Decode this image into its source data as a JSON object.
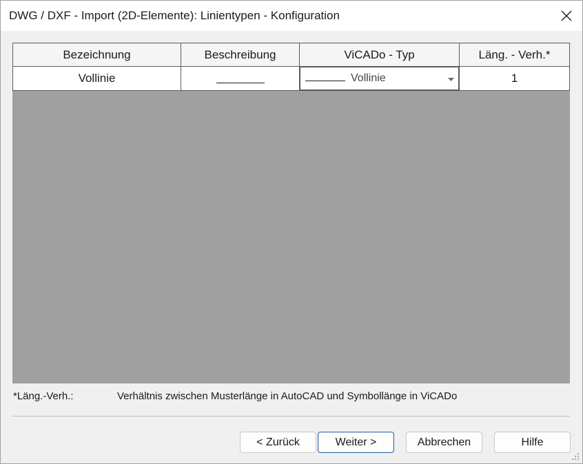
{
  "window": {
    "title": "DWG / DXF - Import (2D-Elemente): Linientypen - Konfiguration"
  },
  "table": {
    "columns": [
      "Bezeichnung",
      "Beschreibung",
      "ViCADo - Typ",
      "Läng. - Verh.*"
    ],
    "rows": [
      {
        "bezeichnung": "Vollinie",
        "beschreibung_icon": "solid-line-sample",
        "vicado_typ": "Vollinie",
        "verhaeltnis": "1"
      }
    ]
  },
  "footnote": {
    "label": "*Läng.-Verh.:",
    "text": "Verhältnis zwischen Musterlänge in AutoCAD  und Symbollänge in ViCADo"
  },
  "buttons": {
    "back": "< Zurück",
    "next": "Weiter >",
    "cancel": "Abbrechen",
    "help": "Hilfe"
  },
  "colors": {
    "grid_background": "#a0a0a0",
    "default_button_border": "#3a6ea8"
  }
}
